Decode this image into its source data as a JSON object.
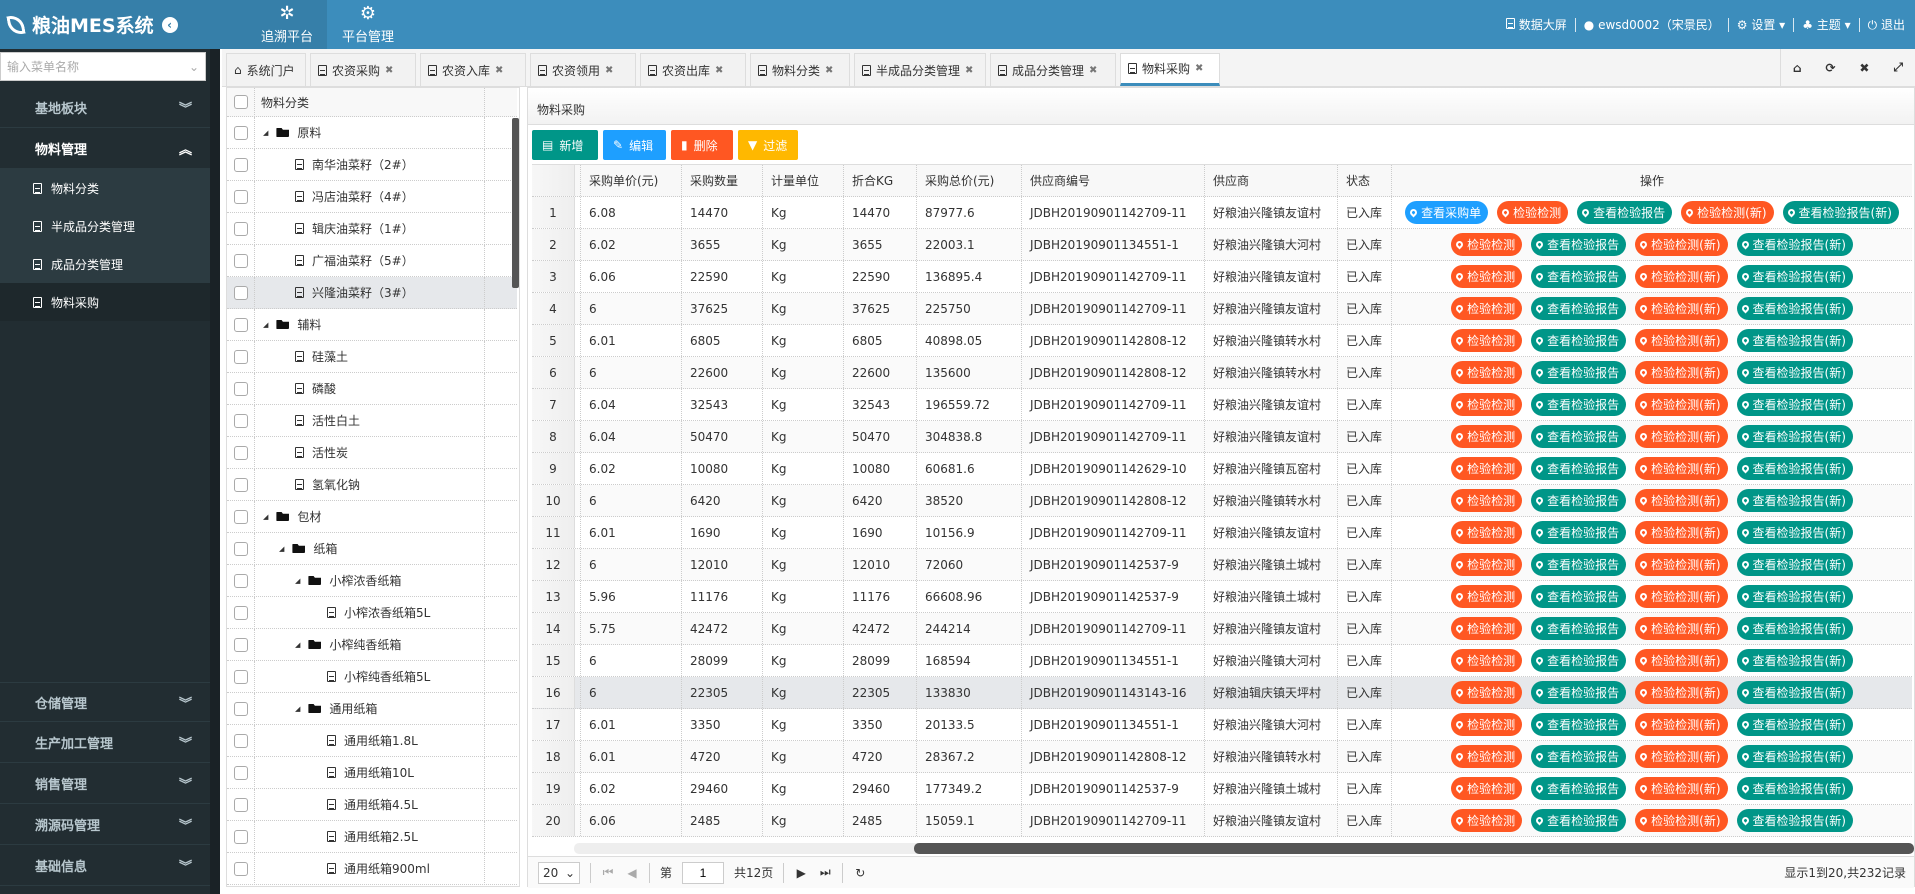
{
  "header": {
    "app_title": "粮油MES系统",
    "nav": [
      {
        "label": "追溯平台",
        "icon": "bug-icon"
      },
      {
        "label": "平台管理",
        "icon": "gear-icon"
      }
    ],
    "right": {
      "data_screen": "数据大屏",
      "user": "ewsd0002（宋景民）",
      "settings": "设置",
      "theme": "主题",
      "logout": "退出"
    }
  },
  "sidebar": {
    "search_placeholder": "输入菜单名称",
    "groups_top": [
      {
        "label": "基地板块"
      },
      {
        "label": "物料管理"
      }
    ],
    "sub_items": [
      {
        "label": "物料分类"
      },
      {
        "label": "半成品分类管理"
      },
      {
        "label": "成品分类管理"
      },
      {
        "label": "物料采购"
      }
    ],
    "groups_bottom": [
      {
        "label": "仓储管理"
      },
      {
        "label": "生产加工管理"
      },
      {
        "label": "销售管理"
      },
      {
        "label": "溯源码管理"
      },
      {
        "label": "基础信息"
      }
    ]
  },
  "tabs": [
    {
      "label": "系统门户",
      "icon": "home-icon"
    },
    {
      "label": "农资采购"
    },
    {
      "label": "农资入库"
    },
    {
      "label": "农资领用"
    },
    {
      "label": "农资出库"
    },
    {
      "label": "物料分类"
    },
    {
      "label": "半成品分类管理"
    },
    {
      "label": "成品分类管理"
    },
    {
      "label": "物料采购",
      "active": true
    }
  ],
  "tree": {
    "header": "物料分类",
    "items": [
      {
        "label": "原料",
        "level": 0,
        "folder": true
      },
      {
        "label": "南华油菜籽（2#）",
        "level": 1
      },
      {
        "label": "冯店油菜籽（4#）",
        "level": 1
      },
      {
        "label": "辑庆油菜籽（1#）",
        "level": 1
      },
      {
        "label": "广福油菜籽（5#）",
        "level": 1
      },
      {
        "label": "兴隆油菜籽（3#）",
        "level": 1,
        "selected": true
      },
      {
        "label": "辅料",
        "level": 0,
        "folder": true
      },
      {
        "label": "硅藻土",
        "level": 1
      },
      {
        "label": "磷酸",
        "level": 1
      },
      {
        "label": "活性白土",
        "level": 1
      },
      {
        "label": "活性炭",
        "level": 1
      },
      {
        "label": "氢氧化钠",
        "level": 1
      },
      {
        "label": "包材",
        "level": 0,
        "folder": true
      },
      {
        "label": "纸箱",
        "level": 1,
        "folder": true
      },
      {
        "label": "小榨浓香纸箱",
        "level": 2,
        "folder": true
      },
      {
        "label": "小榨浓香纸箱5L",
        "level": 3
      },
      {
        "label": "小榨纯香纸箱",
        "level": 2,
        "folder": true
      },
      {
        "label": "小榨纯香纸箱5L",
        "level": 3
      },
      {
        "label": "通用纸箱",
        "level": 2,
        "folder": true
      },
      {
        "label": "通用纸箱1.8L",
        "level": 3
      },
      {
        "label": "通用纸箱10L",
        "level": 3
      },
      {
        "label": "通用纸箱4.5L",
        "level": 3
      },
      {
        "label": "通用纸箱2.5L",
        "level": 3
      },
      {
        "label": "通用纸箱900ml",
        "level": 3
      }
    ]
  },
  "main": {
    "title": "物料采购",
    "toolbar": [
      {
        "label": "新增",
        "color": "#009688",
        "icon": "file-icon"
      },
      {
        "label": "编辑",
        "color": "#1e9fff",
        "icon": "pencil-icon"
      },
      {
        "label": "删除",
        "color": "#ff5722",
        "icon": "trash-icon"
      },
      {
        "label": "过滤",
        "color": "#ffb800",
        "icon": "filter-icon"
      }
    ],
    "columns": [
      "采购单价(元)",
      "采购数量",
      "计量单位",
      "折合KG",
      "采购总价(元)",
      "供应商编号",
      "供应商",
      "状态",
      "操作"
    ],
    "actions_first": [
      {
        "label": "查看采购单",
        "color": "#1e9fff"
      },
      {
        "label": "检验检测",
        "color": "#ff5722"
      },
      {
        "label": "查看检验报告",
        "color": "#009688"
      },
      {
        "label": "检验检测(新)",
        "color": "#ff5722"
      },
      {
        "label": "查看检验报告(新)",
        "color": "#009688"
      }
    ],
    "actions": [
      {
        "label": "检验检测",
        "color": "#ff5722"
      },
      {
        "label": "查看检验报告",
        "color": "#009688"
      },
      {
        "label": "检验检测(新)",
        "color": "#ff5722"
      },
      {
        "label": "查看检验报告(新)",
        "color": "#009688"
      }
    ],
    "rows": [
      [
        "1",
        "6.08",
        "14470",
        "Kg",
        "14470",
        "87977.6",
        "JDBH20190901142709-11",
        "好粮油兴隆镇友谊村",
        "已入库"
      ],
      [
        "2",
        "6.02",
        "3655",
        "Kg",
        "3655",
        "22003.1",
        "JDBH20190901134551-1",
        "好粮油兴隆镇大河村",
        "已入库"
      ],
      [
        "3",
        "6.06",
        "22590",
        "Kg",
        "22590",
        "136895.4",
        "JDBH20190901142709-11",
        "好粮油兴隆镇友谊村",
        "已入库"
      ],
      [
        "4",
        "6",
        "37625",
        "Kg",
        "37625",
        "225750",
        "JDBH20190901142709-11",
        "好粮油兴隆镇友谊村",
        "已入库"
      ],
      [
        "5",
        "6.01",
        "6805",
        "Kg",
        "6805",
        "40898.05",
        "JDBH20190901142808-12",
        "好粮油兴隆镇转水村",
        "已入库"
      ],
      [
        "6",
        "6",
        "22600",
        "Kg",
        "22600",
        "135600",
        "JDBH20190901142808-12",
        "好粮油兴隆镇转水村",
        "已入库"
      ],
      [
        "7",
        "6.04",
        "32543",
        "Kg",
        "32543",
        "196559.72",
        "JDBH20190901142709-11",
        "好粮油兴隆镇友谊村",
        "已入库"
      ],
      [
        "8",
        "6.04",
        "50470",
        "Kg",
        "50470",
        "304838.8",
        "JDBH20190901142709-11",
        "好粮油兴隆镇友谊村",
        "已入库"
      ],
      [
        "9",
        "6.02",
        "10080",
        "Kg",
        "10080",
        "60681.6",
        "JDBH20190901142629-10",
        "好粮油兴隆镇瓦窑村",
        "已入库"
      ],
      [
        "10",
        "6",
        "6420",
        "Kg",
        "6420",
        "38520",
        "JDBH20190901142808-12",
        "好粮油兴隆镇转水村",
        "已入库"
      ],
      [
        "11",
        "6.01",
        "1690",
        "Kg",
        "1690",
        "10156.9",
        "JDBH20190901142709-11",
        "好粮油兴隆镇友谊村",
        "已入库"
      ],
      [
        "12",
        "6",
        "12010",
        "Kg",
        "12010",
        "72060",
        "JDBH20190901142537-9",
        "好粮油兴隆镇土城村",
        "已入库"
      ],
      [
        "13",
        "5.96",
        "11176",
        "Kg",
        "11176",
        "66608.96",
        "JDBH20190901142537-9",
        "好粮油兴隆镇土城村",
        "已入库"
      ],
      [
        "14",
        "5.75",
        "42472",
        "Kg",
        "42472",
        "244214",
        "JDBH20190901142709-11",
        "好粮油兴隆镇友谊村",
        "已入库"
      ],
      [
        "15",
        "6",
        "28099",
        "Kg",
        "28099",
        "168594",
        "JDBH20190901134551-1",
        "好粮油兴隆镇大河村",
        "已入库"
      ],
      [
        "16",
        "6",
        "22305",
        "Kg",
        "22305",
        "133830",
        "JDBH20190901143143-16",
        "好粮油辑庆镇天坪村",
        "已入库"
      ],
      [
        "17",
        "6.01",
        "3350",
        "Kg",
        "3350",
        "20133.5",
        "JDBH20190901134551-1",
        "好粮油兴隆镇大河村",
        "已入库"
      ],
      [
        "18",
        "6.01",
        "4720",
        "Kg",
        "4720",
        "28367.2",
        "JDBH20190901142808-12",
        "好粮油兴隆镇转水村",
        "已入库"
      ],
      [
        "19",
        "6.02",
        "29460",
        "Kg",
        "29460",
        "177349.2",
        "JDBH20190901142537-9",
        "好粮油兴隆镇土城村",
        "已入库"
      ],
      [
        "20",
        "6.06",
        "2485",
        "Kg",
        "2485",
        "15059.1",
        "JDBH20190901142709-11",
        "好粮油兴隆镇友谊村",
        "已入库"
      ]
    ],
    "highlighted_row": 16,
    "pager": {
      "page_size": "20",
      "page_prefix": "第",
      "page": "1",
      "page_total": "共12页",
      "info": "显示1到20,共232记录"
    }
  }
}
